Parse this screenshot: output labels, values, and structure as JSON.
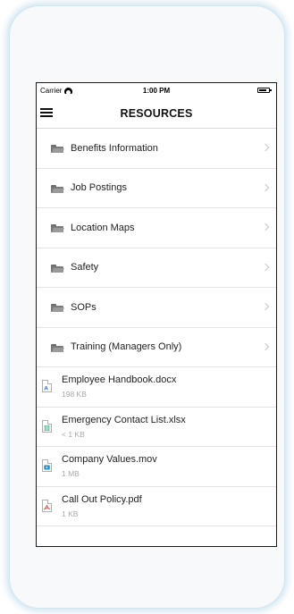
{
  "status_bar": {
    "carrier": "Carrier",
    "time": "1:00 PM"
  },
  "nav": {
    "title": "RESOURCES"
  },
  "folders": [
    {
      "label": "Benefits Information"
    },
    {
      "label": "Job Postings"
    },
    {
      "label": "Location Maps"
    },
    {
      "label": "Safety"
    },
    {
      "label": "SOPs"
    },
    {
      "label": "Training (Managers Only)"
    }
  ],
  "files": [
    {
      "name": "Employee Handbook.docx",
      "size": "198 KB",
      "icon": "word-doc-icon",
      "color": "#2b5fb4"
    },
    {
      "name": "Emergency Contact List.xlsx",
      "size": "< 1 KB",
      "icon": "spreadsheet-icon",
      "color": "#5fc1a6"
    },
    {
      "name": "Company Values.mov",
      "size": "1 MB",
      "icon": "video-file-icon",
      "color": "#1f8fd6"
    },
    {
      "name": "Call Out Policy.pdf",
      "size": "1 KB",
      "icon": "pdf-icon",
      "color": "#d9342b"
    }
  ]
}
